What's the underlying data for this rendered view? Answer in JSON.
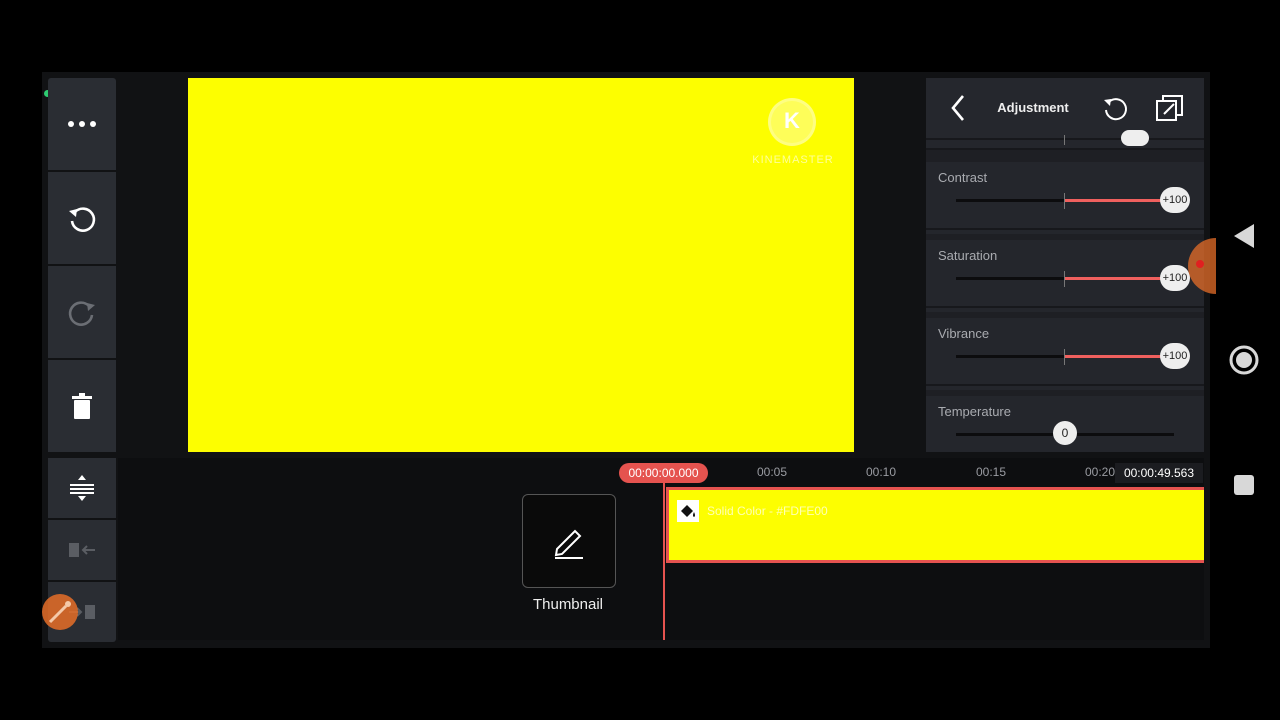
{
  "panel": {
    "title": "Adjustment",
    "rows": [
      {
        "label": "Contrast",
        "value_text": "+100",
        "value": 100
      },
      {
        "label": "Saturation",
        "value_text": "+100",
        "value": 100
      },
      {
        "label": "Vibrance",
        "value_text": "+100",
        "value": 100
      },
      {
        "label": "Temperature",
        "value_text": "0",
        "value": 0
      }
    ]
  },
  "watermark": {
    "letter": "K",
    "text": "KINEMASTER"
  },
  "preview": {
    "color": "#FDFE00"
  },
  "timeline": {
    "playhead_time": "00:00:00.000",
    "total_time": "00:00:49.563",
    "ruler": [
      "00:05",
      "00:10",
      "00:15",
      "00:20"
    ],
    "clip_label": "Solid Color - #FDFE00",
    "thumbnail_label": "Thumbnail"
  },
  "colors": {
    "accent": "#E5534F",
    "clip": "#FDFE00",
    "toolbar": "#2A2D33"
  },
  "icons": [
    "more-icon",
    "undo-icon",
    "redo-icon",
    "delete-icon",
    "expand-track-icon",
    "jump-start-icon",
    "jump-end-icon",
    "back-icon",
    "reset-icon",
    "copy-all-icon",
    "edit-pencil-icon",
    "paint-bucket-icon"
  ]
}
